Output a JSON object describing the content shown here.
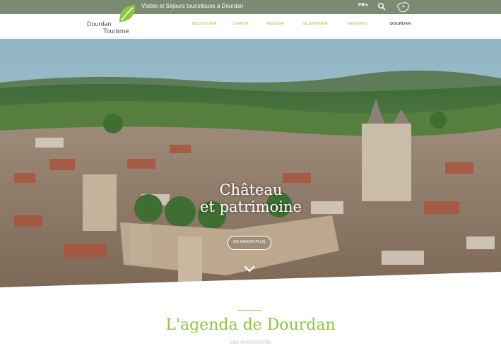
{
  "topbar": {
    "tagline": "Visites et Séjours touristiques à Dourdan",
    "language": "FR",
    "language_caret": "▾"
  },
  "logo": {
    "line1": "Dourdan",
    "line2": "Tourisme"
  },
  "nav": {
    "items": [
      {
        "label": "DÉCOUVRIR"
      },
      {
        "label": "SORTIR"
      },
      {
        "label": "AGENDA"
      },
      {
        "label": "SÉJOURNER"
      },
      {
        "label": "GROUPES"
      },
      {
        "label": "DOURDAN"
      }
    ]
  },
  "hero": {
    "title_line1": "Château",
    "title_line2": "et patrimoine",
    "cta_label": "EN SAVOIR PLUS"
  },
  "agenda": {
    "title": "L'agenda de Dourdan",
    "subtitle": "Les évènements"
  },
  "colors": {
    "accent_green": "#8cc83e",
    "topbar_bg": "#7b8a73"
  },
  "icons": {
    "search": "search-icon",
    "map": "map-icon",
    "scroll": "chevron-down-icon"
  }
}
